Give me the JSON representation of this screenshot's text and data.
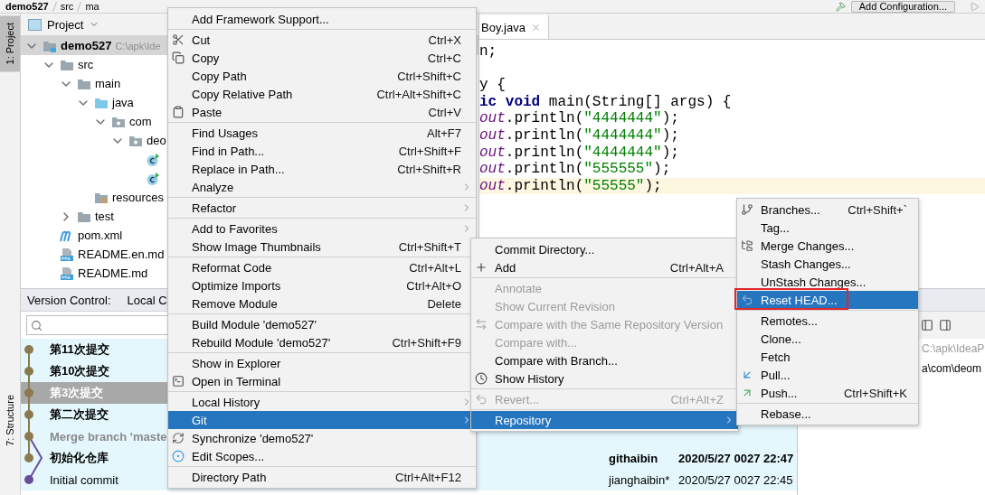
{
  "breadcrumbs": [
    "demo527",
    "src",
    "ma"
  ],
  "toolbar": {
    "run_config": "Add Configuration..."
  },
  "tool_strip": [
    {
      "label": "1: Project",
      "selected": true
    },
    {
      "label": "7: Structure",
      "selected": false
    }
  ],
  "project": {
    "title": "Project",
    "tree": [
      {
        "label": "demo527",
        "path": "C:\\apk\\Ide",
        "kind": "module",
        "expanded": true,
        "selected": true,
        "children": [
          {
            "label": "src",
            "kind": "folder",
            "expanded": true,
            "selected": false,
            "children": [
              {
                "label": "main",
                "kind": "folder",
                "expanded": true,
                "selected": false,
                "children": [
                  {
                    "label": "java",
                    "kind": "source",
                    "expanded": true,
                    "selected": false,
                    "children": [
                      {
                        "label": "com",
                        "kind": "package",
                        "expanded": true,
                        "selected": false,
                        "children": [
                          {
                            "label": "deo",
                            "kind": "package",
                            "expanded": true,
                            "selected": false,
                            "children": [
                              {
                                "kind": "class",
                                "selected": false
                              },
                              {
                                "kind": "class",
                                "selected": false
                              }
                            ]
                          }
                        ]
                      }
                    ]
                  },
                  {
                    "label": "resources",
                    "kind": "resources",
                    "selected": false
                  }
                ]
              },
              {
                "label": "test",
                "kind": "folder",
                "expanded": false,
                "selected": false
              }
            ]
          },
          {
            "label": "pom.xml",
            "kind": "maven",
            "selected": false
          },
          {
            "label": "README.en.md",
            "kind": "markdown",
            "selected": false
          },
          {
            "label": "README.md",
            "kind": "markdown",
            "selected": false
          }
        ]
      }
    ]
  },
  "editor": {
    "tab": "Boy.java",
    "lines": [
      {
        "current": false,
        "blank_before": false,
        "tokens": [
          {
            "text": "n;",
            "kind": "plain"
          }
        ]
      },
      {
        "current": false,
        "blank_before": true,
        "tokens": [
          {
            "text": "y {",
            "kind": "plain"
          }
        ]
      },
      {
        "current": false,
        "blank_before": false,
        "tokens": [
          {
            "text": "ic void",
            "kind": "keyword"
          },
          {
            "text": " main(String[] args) {",
            "kind": "plain"
          }
        ]
      },
      {
        "current": false,
        "blank_before": false,
        "tokens": [
          {
            "text": "out",
            "kind": "field"
          },
          {
            "text": ".println(",
            "kind": "plain"
          },
          {
            "text": "\"4444444\"",
            "kind": "string"
          },
          {
            "text": ");",
            "kind": "plain"
          }
        ]
      },
      {
        "current": false,
        "blank_before": false,
        "tokens": [
          {
            "text": "out",
            "kind": "field"
          },
          {
            "text": ".println(",
            "kind": "plain"
          },
          {
            "text": "\"4444444\"",
            "kind": "string"
          },
          {
            "text": ");",
            "kind": "plain"
          }
        ]
      },
      {
        "current": false,
        "blank_before": false,
        "tokens": [
          {
            "text": "out",
            "kind": "field"
          },
          {
            "text": ".println(",
            "kind": "plain"
          },
          {
            "text": "\"4444444\"",
            "kind": "string"
          },
          {
            "text": ");",
            "kind": "plain"
          }
        ]
      },
      {
        "current": false,
        "blank_before": false,
        "tokens": [
          {
            "text": "out",
            "kind": "field"
          },
          {
            "text": ".println(",
            "kind": "plain"
          },
          {
            "text": "\"555555\"",
            "kind": "string"
          },
          {
            "text": ");",
            "kind": "plain"
          }
        ]
      },
      {
        "current": true,
        "blank_before": false,
        "tokens": [
          {
            "text": "out",
            "kind": "field"
          },
          {
            "text": ".println(",
            "kind": "plain"
          },
          {
            "text": "\"55555\"",
            "kind": "string"
          },
          {
            "text": ");",
            "kind": "plain"
          }
        ]
      }
    ]
  },
  "version_control": {
    "title": "Version Control:",
    "tab": "Local C",
    "commits": [
      {
        "message": "第11次提交",
        "bold": true,
        "dimmed": false,
        "selected": false,
        "color": "#8c7a4e"
      },
      {
        "message": "第10次提交",
        "bold": true,
        "dimmed": false,
        "selected": false,
        "color": "#8c7a4e"
      },
      {
        "message": "第3次提交",
        "bold": true,
        "dimmed": false,
        "selected": true,
        "color": "#8c7a4e"
      },
      {
        "message": "第二次提交",
        "bold": true,
        "dimmed": false,
        "selected": false,
        "color": "#8c7a4e"
      },
      {
        "message": "Merge branch 'maste",
        "bold": true,
        "dimmed": true,
        "selected": false,
        "color": "#8c7a4e"
      },
      {
        "message": "初始化仓库",
        "bold": true,
        "dimmed": false,
        "selected": false,
        "color": "#8c7a4e",
        "author": "githaibin",
        "date": "2020/5/27 0027 22:47"
      },
      {
        "message": "Initial commit",
        "bold": false,
        "dimmed": false,
        "selected": false,
        "color": "#6a4c9c",
        "author": "jianghaibin*",
        "date": "2020/5/27 0027 22:45"
      }
    ],
    "details": [
      "C:\\apk\\IdeaP",
      "a\\com\\deom"
    ]
  },
  "context_menu": [
    [
      {
        "label": "Add Framework Support...",
        "submenu": false,
        "selected": false
      }
    ],
    [
      {
        "label": "Cut",
        "shortcut": "Ctrl+X",
        "submenu": false,
        "selected": false
      },
      {
        "label": "Copy",
        "shortcut": "Ctrl+C",
        "submenu": false,
        "selected": false
      },
      {
        "label": "Copy Path",
        "shortcut": "Ctrl+Shift+C",
        "submenu": false,
        "selected": false
      },
      {
        "label": "Copy Relative Path",
        "shortcut": "Ctrl+Alt+Shift+C",
        "submenu": false,
        "selected": false
      },
      {
        "label": "Paste",
        "shortcut": "Ctrl+V",
        "submenu": false,
        "selected": false
      }
    ],
    [
      {
        "label": "Find Usages",
        "shortcut": "Alt+F7",
        "submenu": false,
        "selected": false
      },
      {
        "label": "Find in Path...",
        "shortcut": "Ctrl+Shift+F",
        "submenu": false,
        "selected": false
      },
      {
        "label": "Replace in Path...",
        "shortcut": "Ctrl+Shift+R",
        "submenu": false,
        "selected": false
      },
      {
        "label": "Analyze",
        "submenu": true,
        "selected": false
      }
    ],
    [
      {
        "label": "Refactor",
        "submenu": true,
        "selected": false
      }
    ],
    [
      {
        "label": "Add to Favorites",
        "submenu": true,
        "selected": false
      },
      {
        "label": "Show Image Thumbnails",
        "shortcut": "Ctrl+Shift+T",
        "submenu": false,
        "selected": false
      }
    ],
    [
      {
        "label": "Reformat Code",
        "shortcut": "Ctrl+Alt+L",
        "submenu": false,
        "selected": false
      },
      {
        "label": "Optimize Imports",
        "shortcut": "Ctrl+Alt+O",
        "submenu": false,
        "selected": false
      },
      {
        "label": "Remove Module",
        "shortcut": "Delete",
        "submenu": false,
        "selected": false
      }
    ],
    [
      {
        "label": "Build Module 'demo527'",
        "submenu": false,
        "selected": false
      },
      {
        "label": "Rebuild Module 'demo527'",
        "shortcut": "Ctrl+Shift+F9",
        "submenu": false,
        "selected": false
      }
    ],
    [
      {
        "label": "Show in Explorer",
        "submenu": false,
        "selected": false
      },
      {
        "label": "Open in Terminal",
        "submenu": false,
        "selected": false
      }
    ],
    [
      {
        "label": "Local History",
        "submenu": true,
        "selected": false
      },
      {
        "label": "Git",
        "submenu": true,
        "selected": true
      },
      {
        "label": "Synchronize 'demo527'",
        "submenu": false,
        "selected": false
      },
      {
        "label": "Edit Scopes...",
        "submenu": false,
        "selected": false
      }
    ],
    [
      {
        "label": "Directory Path",
        "shortcut": "Ctrl+Alt+F12",
        "submenu": false,
        "selected": false
      }
    ]
  ],
  "git_menu": [
    [
      {
        "label": "Commit Directory...",
        "submenu": false,
        "disabled": false,
        "selected": false
      },
      {
        "label": "Add",
        "shortcut": "Ctrl+Alt+A",
        "submenu": false,
        "disabled": false,
        "selected": false
      }
    ],
    [
      {
        "label": "Annotate",
        "submenu": false,
        "disabled": true,
        "selected": false
      },
      {
        "label": "Show Current Revision",
        "submenu": false,
        "disabled": true,
        "selected": false
      },
      {
        "label": "Compare with the Same Repository Version",
        "submenu": false,
        "disabled": true,
        "selected": false
      },
      {
        "label": "Compare with...",
        "submenu": false,
        "disabled": true,
        "selected": false
      },
      {
        "label": "Compare with Branch...",
        "submenu": false,
        "disabled": false,
        "selected": false
      },
      {
        "label": "Show History",
        "submenu": false,
        "disabled": false,
        "selected": false
      }
    ],
    [
      {
        "label": "Revert...",
        "shortcut": "Ctrl+Alt+Z",
        "submenu": false,
        "disabled": true,
        "selected": false
      }
    ],
    [
      {
        "label": "Repository",
        "submenu": true,
        "disabled": false,
        "selected": true
      }
    ]
  ],
  "repository_menu": [
    [
      {
        "label": "Branches...",
        "shortcut": "Ctrl+Shift+`",
        "submenu": false,
        "selected": false,
        "outlined": false
      },
      {
        "label": "Tag...",
        "submenu": false,
        "selected": false,
        "outlined": false
      },
      {
        "label": "Merge Changes...",
        "submenu": false,
        "selected": false,
        "outlined": false
      },
      {
        "label": "Stash Changes...",
        "submenu": false,
        "selected": false,
        "outlined": false
      },
      {
        "label": "UnStash Changes...",
        "submenu": false,
        "selected": false,
        "outlined": false
      },
      {
        "label": "Reset HEAD...",
        "submenu": false,
        "selected": true,
        "outlined": true
      }
    ],
    [
      {
        "label": "Remotes...",
        "submenu": false,
        "selected": false,
        "outlined": false
      },
      {
        "label": "Clone...",
        "submenu": false,
        "selected": false,
        "outlined": false
      },
      {
        "label": "Fetch",
        "submenu": false,
        "selected": false,
        "outlined": false
      },
      {
        "label": "Pull...",
        "submenu": false,
        "selected": false,
        "outlined": false
      },
      {
        "label": "Push...",
        "shortcut": "Ctrl+Shift+K",
        "submenu": false,
        "selected": false,
        "outlined": false
      }
    ],
    [
      {
        "label": "Rebase...",
        "submenu": false,
        "selected": false,
        "outlined": false
      }
    ]
  ]
}
